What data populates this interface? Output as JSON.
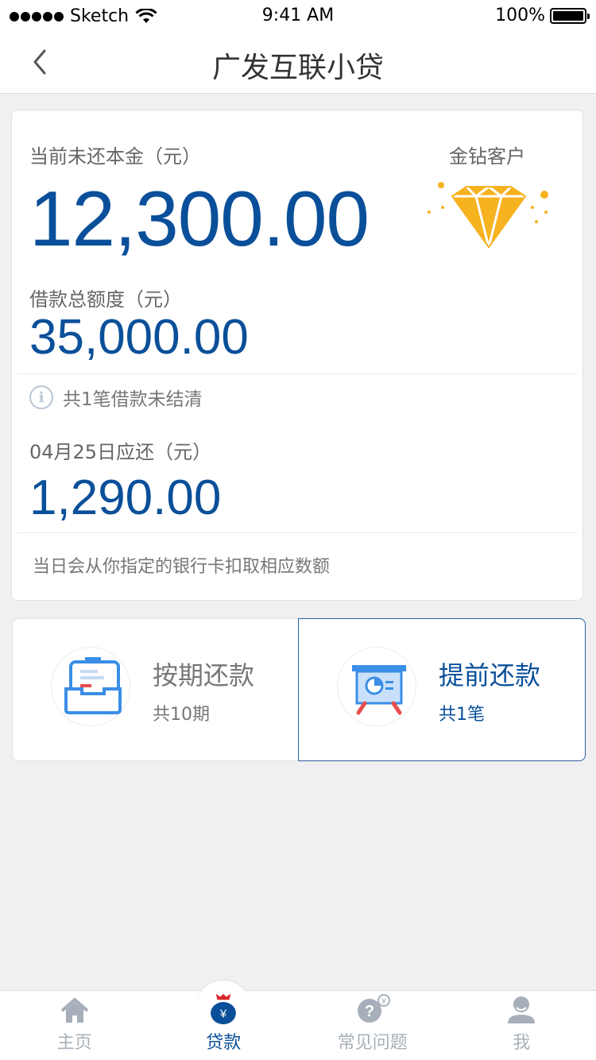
{
  "status_bar": {
    "carrier": "Sketch",
    "time": "9:41 AM",
    "battery": "100%"
  },
  "nav": {
    "title": "广发互联小贷",
    "back_icon": "chevron-left-icon"
  },
  "summary": {
    "principal_label": "当前未还本金（元）",
    "principal_value": "12,300.00",
    "vip_label": "金钻客户",
    "vip_icon": "diamond-icon",
    "limit_label": "借款总额度（元）",
    "limit_value": "35,000.00",
    "info_text": "共1笔借款未结清",
    "due_label": "04月25日应还（元）",
    "due_value": "1,290.00",
    "footnote": "当日会从你指定的银行卡扣取相应数额"
  },
  "options": [
    {
      "title": "按期还款",
      "subtitle": "共10期",
      "icon": "inbox-tray-icon"
    },
    {
      "title": "提前还款",
      "subtitle": "共1笔",
      "icon": "presentation-board-icon"
    }
  ],
  "tabs": [
    {
      "label": "主页",
      "icon": "home-icon",
      "active": false
    },
    {
      "label": "贷款",
      "icon": "money-bag-icon",
      "active": true
    },
    {
      "label": "常见问题",
      "icon": "question-icon",
      "active": false
    },
    {
      "label": "我",
      "icon": "user-icon",
      "active": false
    }
  ],
  "colors": {
    "accent": "#0a4f99",
    "gold": "#f7b21f",
    "inactive": "#a7b0ba"
  }
}
